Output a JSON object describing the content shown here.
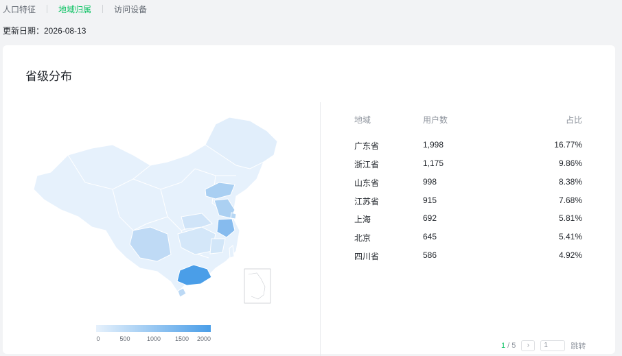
{
  "tabs": [
    {
      "label": "人口特征",
      "active": false
    },
    {
      "label": "地域归属",
      "active": true
    },
    {
      "label": "访问设备",
      "active": false
    }
  ],
  "update": {
    "text": "更新日期：2026-08-13"
  },
  "card": {
    "title": "省级分布"
  },
  "legend": {
    "ticks": [
      "0",
      "500",
      "1000",
      "1500",
      "2000"
    ],
    "min_color": "#e6f1fc",
    "max_color": "#4a9ee8"
  },
  "table": {
    "headers": {
      "region": "地域",
      "users": "用户数",
      "ratio": "占比"
    },
    "rows": [
      {
        "region": "广东省",
        "users": "1,998",
        "ratio": "16.77%"
      },
      {
        "region": "浙江省",
        "users": "1,175",
        "ratio": "9.86%"
      },
      {
        "region": "山东省",
        "users": "998",
        "ratio": "8.38%"
      },
      {
        "region": "江苏省",
        "users": "915",
        "ratio": "7.68%"
      },
      {
        "region": "上海",
        "users": "692",
        "ratio": "5.81%"
      },
      {
        "region": "北京",
        "users": "645",
        "ratio": "5.41%"
      },
      {
        "region": "四川省",
        "users": "586",
        "ratio": "4.92%"
      }
    ]
  },
  "pager": {
    "current": "1",
    "total_text": "/ 5",
    "next_icon": "chevron-right-icon",
    "input_value": "1",
    "jump_label": "跳转"
  },
  "colors": {
    "accent": "#07c160",
    "map_base": "#e6f1fc",
    "map_high": "#4a9ee8"
  }
}
